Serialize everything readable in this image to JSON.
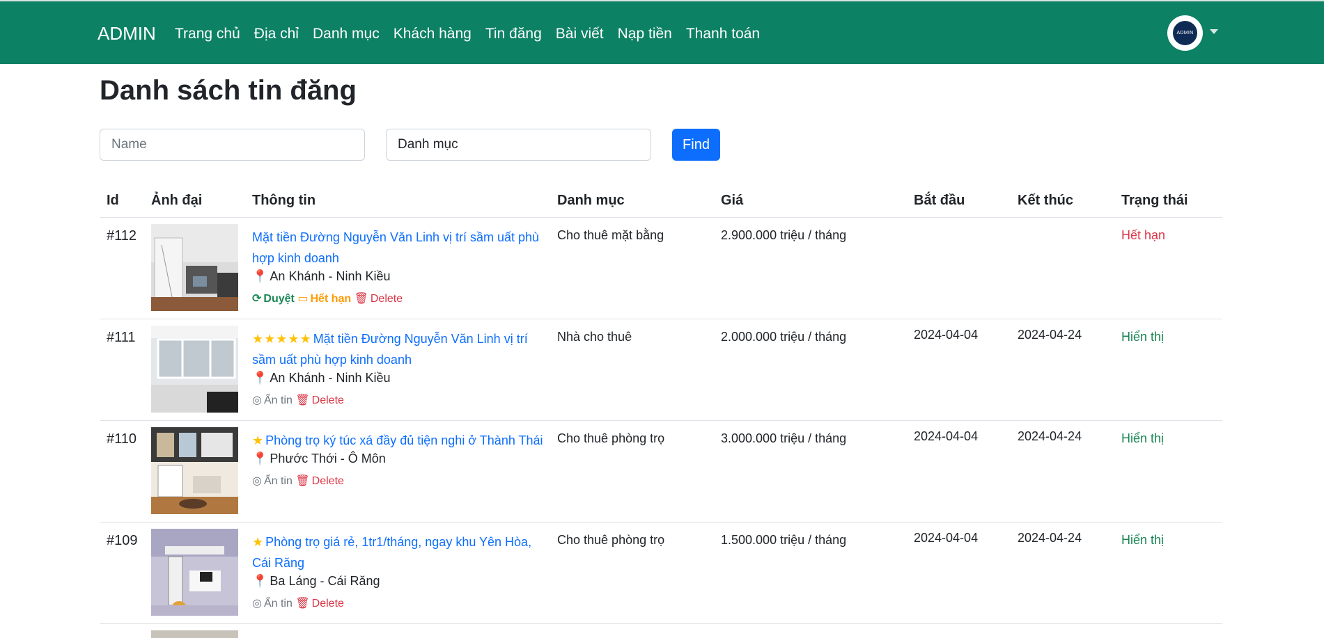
{
  "nav": {
    "brand": "ADMIN",
    "items": [
      "Trang chủ",
      "Địa chỉ",
      "Danh mục",
      "Khách hàng",
      "Tin đăng",
      "Bài viết",
      "Nạp tiền",
      "Thanh toán"
    ],
    "avatar_text": "ADMIN"
  },
  "page": {
    "title": "Danh sách tin đăng"
  },
  "filters": {
    "name_placeholder": "Name",
    "category_value": "Danh mục",
    "find_label": "Find"
  },
  "table": {
    "headers": [
      "Id",
      "Ảnh đại",
      "Thông tin",
      "Danh mục",
      "Giá",
      "Bắt đầu",
      "Kết thúc",
      "Trạng thái"
    ],
    "rows": [
      {
        "id": "#112",
        "stars": "",
        "title": "Mặt tiền Đường Nguyễn Văn Linh vị trí sầm uất phù hợp kinh doanh",
        "location": "An Khánh - Ninh Kiều",
        "actions": [
          "Duyệt",
          "Hết hạn",
          "Delete"
        ],
        "category": "Cho thuê mặt bằng",
        "price": "2.900.000 triệu / tháng",
        "start": "",
        "end": "",
        "status": "Hết hạn"
      },
      {
        "id": "#111",
        "stars": "★★★★★",
        "title": "Mặt tiền Đường Nguyễn Văn Linh vị trí sầm uất phù hợp kinh doanh",
        "location": "An Khánh - Ninh Kiều",
        "actions": [
          "Ẩn tin",
          "Delete"
        ],
        "category": "Nhà cho thuê",
        "price": "2.000.000 triệu / tháng",
        "start": "2024-04-04",
        "end": "2024-04-24",
        "status": "Hiển thị"
      },
      {
        "id": "#110",
        "stars": "★",
        "title": "Phòng trọ ký túc xá đầy đủ tiện nghi ở Thành Thái",
        "location": "Phước Thới - Ô Môn",
        "actions": [
          "Ẩn tin",
          "Delete"
        ],
        "category": "Cho thuê phòng trọ",
        "price": "3.000.000 triệu / tháng",
        "start": "2024-04-04",
        "end": "2024-04-24",
        "status": "Hiển thị"
      },
      {
        "id": "#109",
        "stars": "★",
        "title": "Phòng trọ giá rẻ, 1tr1/tháng, ngay khu Yên Hòa, Cái Răng",
        "location": "Ba Láng - Cái Răng",
        "actions": [
          "Ẩn tin",
          "Delete"
        ],
        "category": "Cho thuê phòng trọ",
        "price": "1.500.000 triệu / tháng",
        "start": "2024-04-04",
        "end": "2024-04-24",
        "status": "Hiển thị"
      }
    ]
  },
  "colors": {
    "navbar": "#0c8164",
    "link": "#0d6efd",
    "danger": "#dc3545",
    "success": "#198754",
    "warning": "#ffc107"
  }
}
